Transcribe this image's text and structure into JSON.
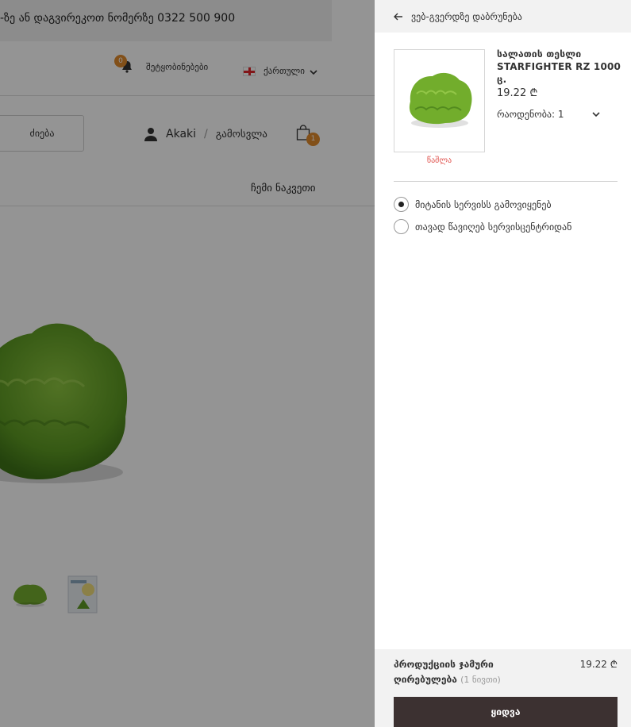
{
  "background": {
    "topbar_text": "-ზე ან დაგვირეკოთ ნომერზე 0322 500 900",
    "notifications": {
      "badge": "0",
      "label": "შეტყობინებები"
    },
    "language": {
      "label": "ქართული"
    },
    "search": {
      "label": "ძიება"
    },
    "user": {
      "name": "Akaki",
      "separator": "/",
      "logout": "გამოსვლა"
    },
    "cart": {
      "badge": "1"
    },
    "my_orders": "ჩემი ნაკვეთი"
  },
  "drawer": {
    "back_label": "ვებ-გვერდზე დაბრუნება",
    "item": {
      "name": "სალათის თესლი STARFIGHTER RZ 1000 ც.",
      "price": "19.22 ₾",
      "quantity_label": "რაოდენობა: 1",
      "remove_label": "წაშლა"
    },
    "delivery_options": [
      {
        "label": "მიტანის სერვისს გამოვიყენებ",
        "selected": true
      },
      {
        "label": "თავად წავიღებ სერვისცენტრიდან",
        "selected": false
      }
    ],
    "footer": {
      "total_label": "პროდუქციის ჯამური ღირებულება",
      "total_count": "(1 ნივთი)",
      "total_value": "19.22 ₾",
      "buy_label": "ყიდვა"
    }
  },
  "colors": {
    "accent_badge": "#e08a2c",
    "buy_button": "#3c3131",
    "remove_link": "#e0504b",
    "overlay": "#000000"
  }
}
